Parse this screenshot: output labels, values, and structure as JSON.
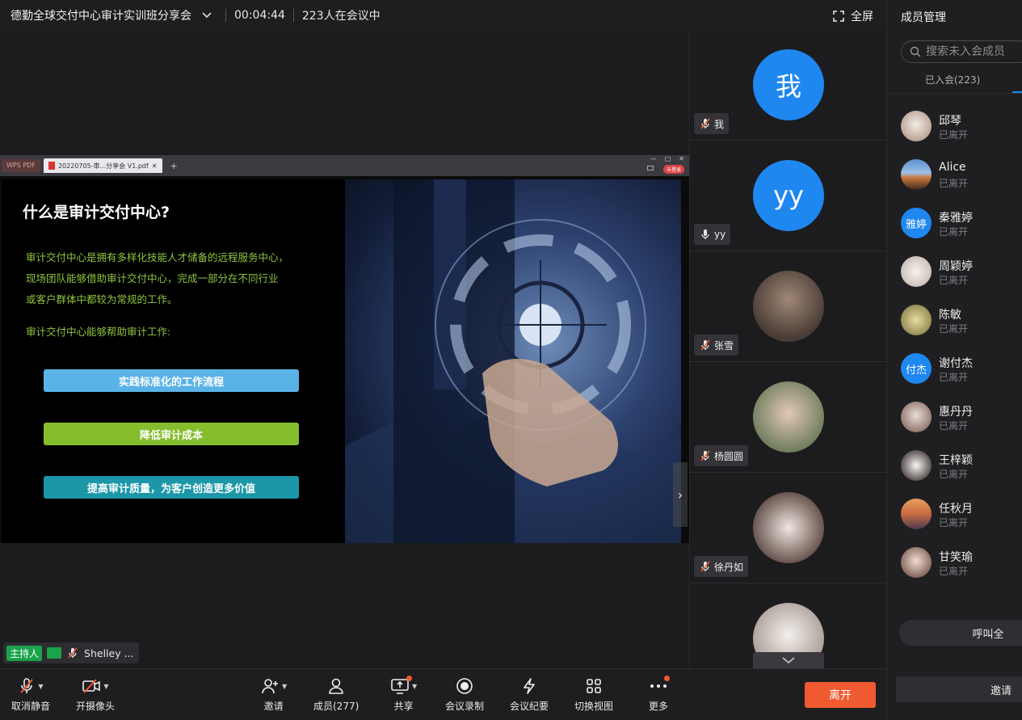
{
  "topbar": {
    "meeting_title": "德勤全球交付中心审计实训班分享会",
    "duration": "00:04:44",
    "participants_in_meeting": "223人在会议中",
    "fullscreen_label": "全屏"
  },
  "pdf_window": {
    "wps_tab": "WPS PDF",
    "doc_tab": "20220705-审...分享会 V1.pdf",
    "login_label": "未登录"
  },
  "slide": {
    "title": "什么是审计交付中心?",
    "paragraph_lines": [
      "审计交付中心是拥有多样化技能人才储备的远程服务中心，",
      "现场团队能够借助审计交付中心，完成一部分在不同行业",
      "或客户群体中都较为常规的工作。"
    ],
    "paragraph2": "审计交付中心能够帮助审计工作:",
    "pills": [
      "实践标准化的工作流程",
      "降低审计成本",
      "提高审计质量，为客户创造更多价值"
    ]
  },
  "host": {
    "badge": "主持人",
    "name": "Shelley ..."
  },
  "video_tiles": [
    {
      "name": "我",
      "avatar_text": "我",
      "avatar_color": "#1e87f0",
      "mic": "off"
    },
    {
      "name": "yy",
      "avatar_text": "yy",
      "avatar_color": "#1e87f0",
      "mic": "on"
    },
    {
      "name": "张雪",
      "avatar_text": "",
      "avatar_color": "#6b5a52",
      "mic": "off"
    },
    {
      "name": "杨圆圆",
      "avatar_text": "",
      "avatar_color": "#8c7a6a",
      "mic": "off"
    },
    {
      "name": "徐丹如",
      "avatar_text": "",
      "avatar_color": "#c9c4c0",
      "mic": "off"
    },
    {
      "name": "",
      "avatar_text": "",
      "avatar_color": "#d8d4d0",
      "mic": "off"
    }
  ],
  "members": {
    "title": "成员管理",
    "search_placeholder": "搜索未入会成员",
    "tab_joined": "已入会(223)",
    "list": [
      {
        "name": "邱琴",
        "status": "已离开",
        "avatar_text": "",
        "avatar_color": "#d9cfc4"
      },
      {
        "name": "Alice",
        "status": "已离开",
        "avatar_text": "",
        "avatar_color": "#4a7fb5"
      },
      {
        "name": "秦雅婷",
        "status": "已离开",
        "avatar_text": "雅婷",
        "avatar_color": "#1e87f0"
      },
      {
        "name": "周颖婷",
        "status": "已离开",
        "avatar_text": "",
        "avatar_color": "#e6e0dc"
      },
      {
        "name": "陈敏",
        "status": "已离开",
        "avatar_text": "",
        "avatar_color": "#c9c08a"
      },
      {
        "name": "谢付杰",
        "status": "已离开",
        "avatar_text": "付杰",
        "avatar_color": "#1e87f0"
      },
      {
        "name": "惠丹丹",
        "status": "已离开",
        "avatar_text": "",
        "avatar_color": "#b9a49a"
      },
      {
        "name": "王梓颖",
        "status": "已离开",
        "avatar_text": "",
        "avatar_color": "#e8e4e0"
      },
      {
        "name": "任秋月",
        "status": "已离开",
        "avatar_text": "",
        "avatar_color": "#c98a5a"
      },
      {
        "name": "甘笑瑜",
        "status": "已离开",
        "avatar_text": "",
        "avatar_color": "#d6c0b4"
      }
    ],
    "call_all_label": "呼叫全",
    "invite_label": "邀请"
  },
  "toolbar": {
    "unmute": "取消静音",
    "camera": "开摄像头",
    "invite": "邀请",
    "members": "成员(277)",
    "share": "共享",
    "record": "会议录制",
    "minutes": "会议纪要",
    "switch_view": "切换视图",
    "more": "更多",
    "leave": "离开"
  },
  "colors": {
    "accent_blue": "#1e87f0",
    "leave_orange": "#f05a30",
    "host_green": "#1aa34a",
    "slide_green_text": "#8fc43e"
  }
}
